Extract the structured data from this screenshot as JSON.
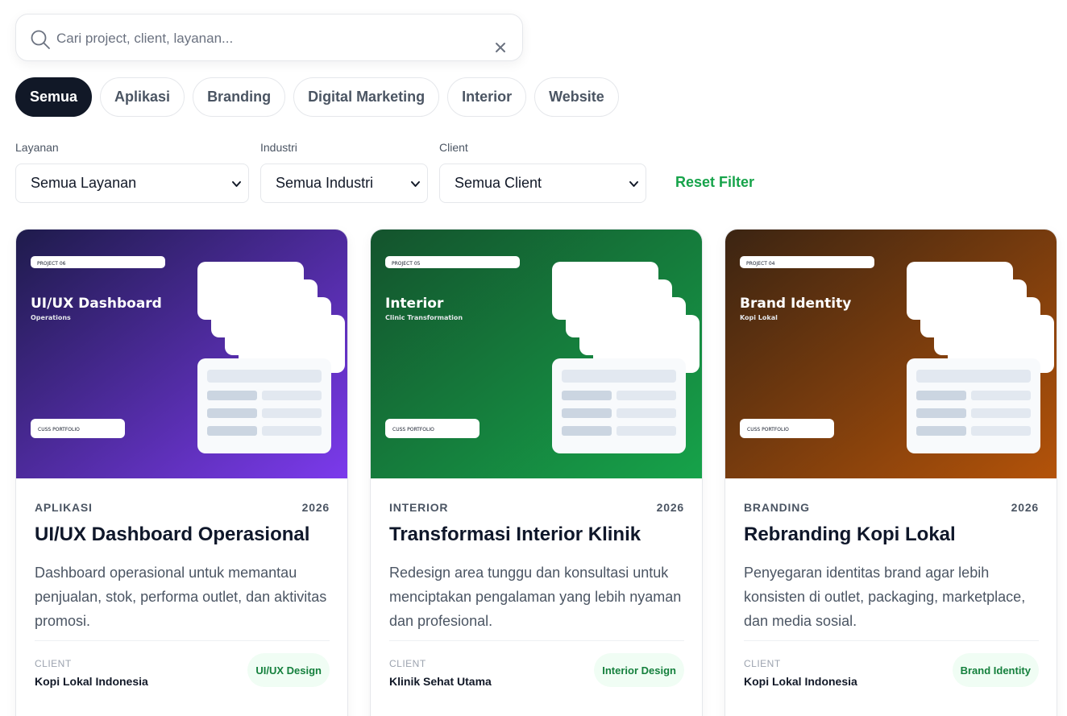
{
  "search": {
    "placeholder": "Cari project, client, layanan...",
    "value": ""
  },
  "tabs": [
    {
      "label": "Semua",
      "active": true
    },
    {
      "label": "Aplikasi",
      "active": false
    },
    {
      "label": "Branding",
      "active": false
    },
    {
      "label": "Digital Marketing",
      "active": false
    },
    {
      "label": "Interior",
      "active": false
    },
    {
      "label": "Website",
      "active": false
    }
  ],
  "filters": {
    "layanan": {
      "label": "Layanan",
      "selected": "Semua Layanan"
    },
    "industri": {
      "label": "Industri",
      "selected": "Semua Industri"
    },
    "client": {
      "label": "Client",
      "selected": "Semua Client"
    },
    "reset_label": "Reset Filter"
  },
  "colors": {
    "accent_green": "#16a34a",
    "active_tab": "#111827",
    "card1_gradient": [
      "#1e1b4b",
      "#7c3aed"
    ],
    "card2_gradient": [
      "#14532d",
      "#16a34a"
    ],
    "card3_gradient": [
      "#3b2412",
      "#b45309"
    ]
  },
  "projects": [
    {
      "thumb_badge": "PROJECT 06",
      "thumb_title": "UI/UX Dashboard",
      "thumb_subtitle": "Operations",
      "thumb_footer": "CUSS PORTFOLIO",
      "category": "APLIKASI",
      "year": "2026",
      "title": "UI/UX Dashboard Operasional",
      "description": "Dashboard operasional untuk memantau penjualan, stok, performa outlet, dan aktivitas promosi.",
      "client_label": "CLIENT",
      "client": "Kopi Lokal Indonesia",
      "service": "UI/UX Design"
    },
    {
      "thumb_badge": "PROJECT 05",
      "thumb_title": "Interior",
      "thumb_subtitle": "Clinic Transformation",
      "thumb_footer": "CUSS PORTFOLIO",
      "category": "INTERIOR",
      "year": "2026",
      "title": "Transformasi Interior Klinik",
      "description": "Redesign area tunggu dan konsultasi untuk menciptakan pengalaman yang lebih nyaman dan profesional.",
      "client_label": "CLIENT",
      "client": "Klinik Sehat Utama",
      "service": "Interior Design"
    },
    {
      "thumb_badge": "PROJECT 04",
      "thumb_title": "Brand Identity",
      "thumb_subtitle": "Kopi Lokal",
      "thumb_footer": "CUSS PORTFOLIO",
      "category": "BRANDING",
      "year": "2026",
      "title": "Rebranding Kopi Lokal",
      "description": "Penyegaran identitas brand agar lebih konsisten di outlet, packaging, marketplace, dan media sosial.",
      "client_label": "CLIENT",
      "client": "Kopi Lokal Indonesia",
      "service": "Brand Identity"
    }
  ]
}
